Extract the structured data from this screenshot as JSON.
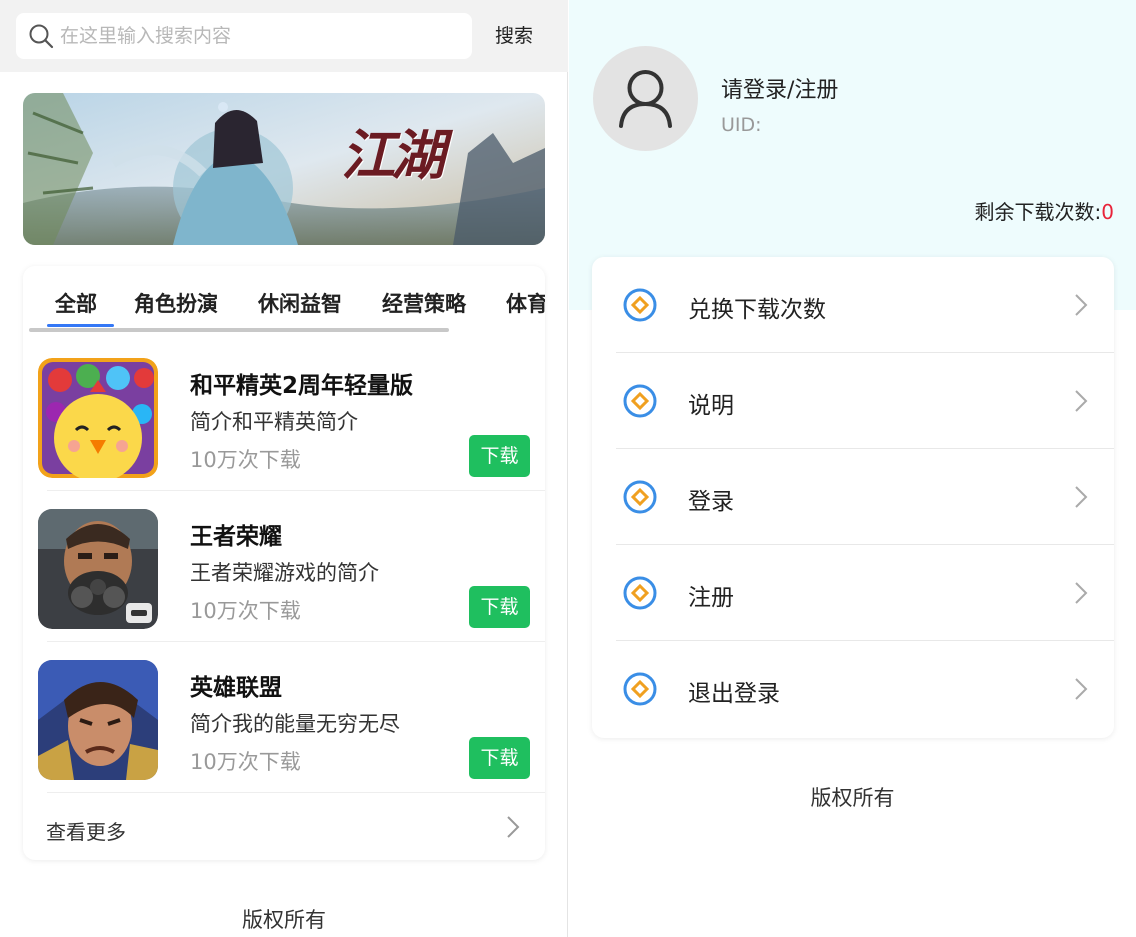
{
  "search": {
    "placeholder": "在这里输入搜索内容",
    "button_label": "搜索"
  },
  "banner": {
    "title": "江湖"
  },
  "tabs": [
    {
      "label": "全部",
      "active": true
    },
    {
      "label": "角色扮演",
      "active": false
    },
    {
      "label": "休闲益智",
      "active": false
    },
    {
      "label": "经营策略",
      "active": false
    },
    {
      "label": "体育",
      "active": false
    }
  ],
  "apps": [
    {
      "name": "和平精英2周年轻量版",
      "desc": "简介和平精英简介",
      "downloads": "10万次下载",
      "button": "下载",
      "icon": "cartoon-chick-game-icon"
    },
    {
      "name": "王者荣耀",
      "desc": "王者荣耀游戏的简介",
      "downloads": "10万次下载",
      "button": "下载",
      "icon": "gas-mask-soldier-game-icon"
    },
    {
      "name": "英雄联盟",
      "desc": "简介我的能量无穷无尽",
      "downloads": "10万次下载",
      "button": "下载",
      "icon": "warrior-hero-game-icon"
    }
  ],
  "more": {
    "label": "查看更多"
  },
  "left_footer": "版权所有",
  "profile": {
    "title": "请登录/注册",
    "uid_label": "UID:",
    "uid_value": "",
    "remain_label": "剩余下载次数:",
    "remain_count": "0"
  },
  "menu": [
    {
      "label": "兑换下载次数"
    },
    {
      "label": "说明"
    },
    {
      "label": "登录"
    },
    {
      "label": "注册"
    },
    {
      "label": "退出登录"
    }
  ],
  "right_footer": "版权所有",
  "colors": {
    "accent": "#3478f6",
    "download_button": "#1fbf5f",
    "warning_count": "#e8243a",
    "header_bg": "#eefcfd",
    "menu_icon_ring": "#3a8ee6",
    "menu_icon_diamond": "#f0a020"
  }
}
